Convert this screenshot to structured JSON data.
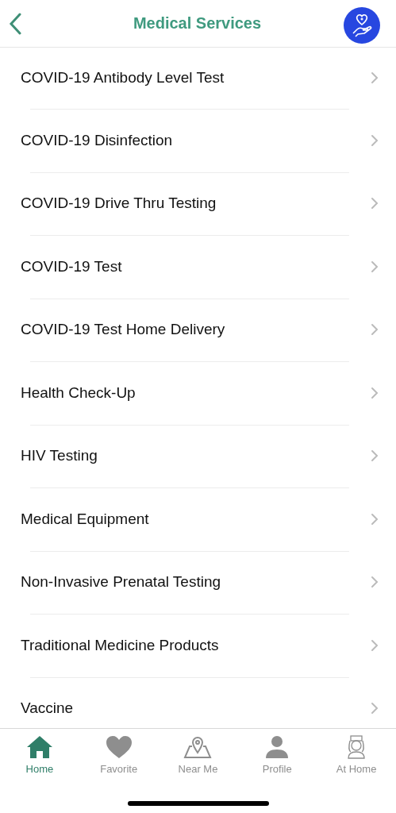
{
  "header": {
    "title": "Medical Services"
  },
  "services": [
    {
      "label": "COVID-19 Antibody Level Test"
    },
    {
      "label": "COVID-19 Disinfection"
    },
    {
      "label": "COVID-19 Drive Thru Testing"
    },
    {
      "label": "COVID-19 Test"
    },
    {
      "label": "COVID-19 Test Home Delivery"
    },
    {
      "label": "Health Check-Up"
    },
    {
      "label": "HIV Testing"
    },
    {
      "label": "Medical Equipment"
    },
    {
      "label": "Non-Invasive Prenatal Testing"
    },
    {
      "label": "Traditional Medicine Products"
    },
    {
      "label": "Vaccine"
    }
  ],
  "tab_bar": [
    {
      "label": "Home",
      "selected": true
    },
    {
      "label": "Favorite",
      "selected": false
    },
    {
      "label": "Near Me",
      "selected": false
    },
    {
      "label": "Profile",
      "selected": false
    },
    {
      "label": "At Home",
      "selected": false
    }
  ]
}
